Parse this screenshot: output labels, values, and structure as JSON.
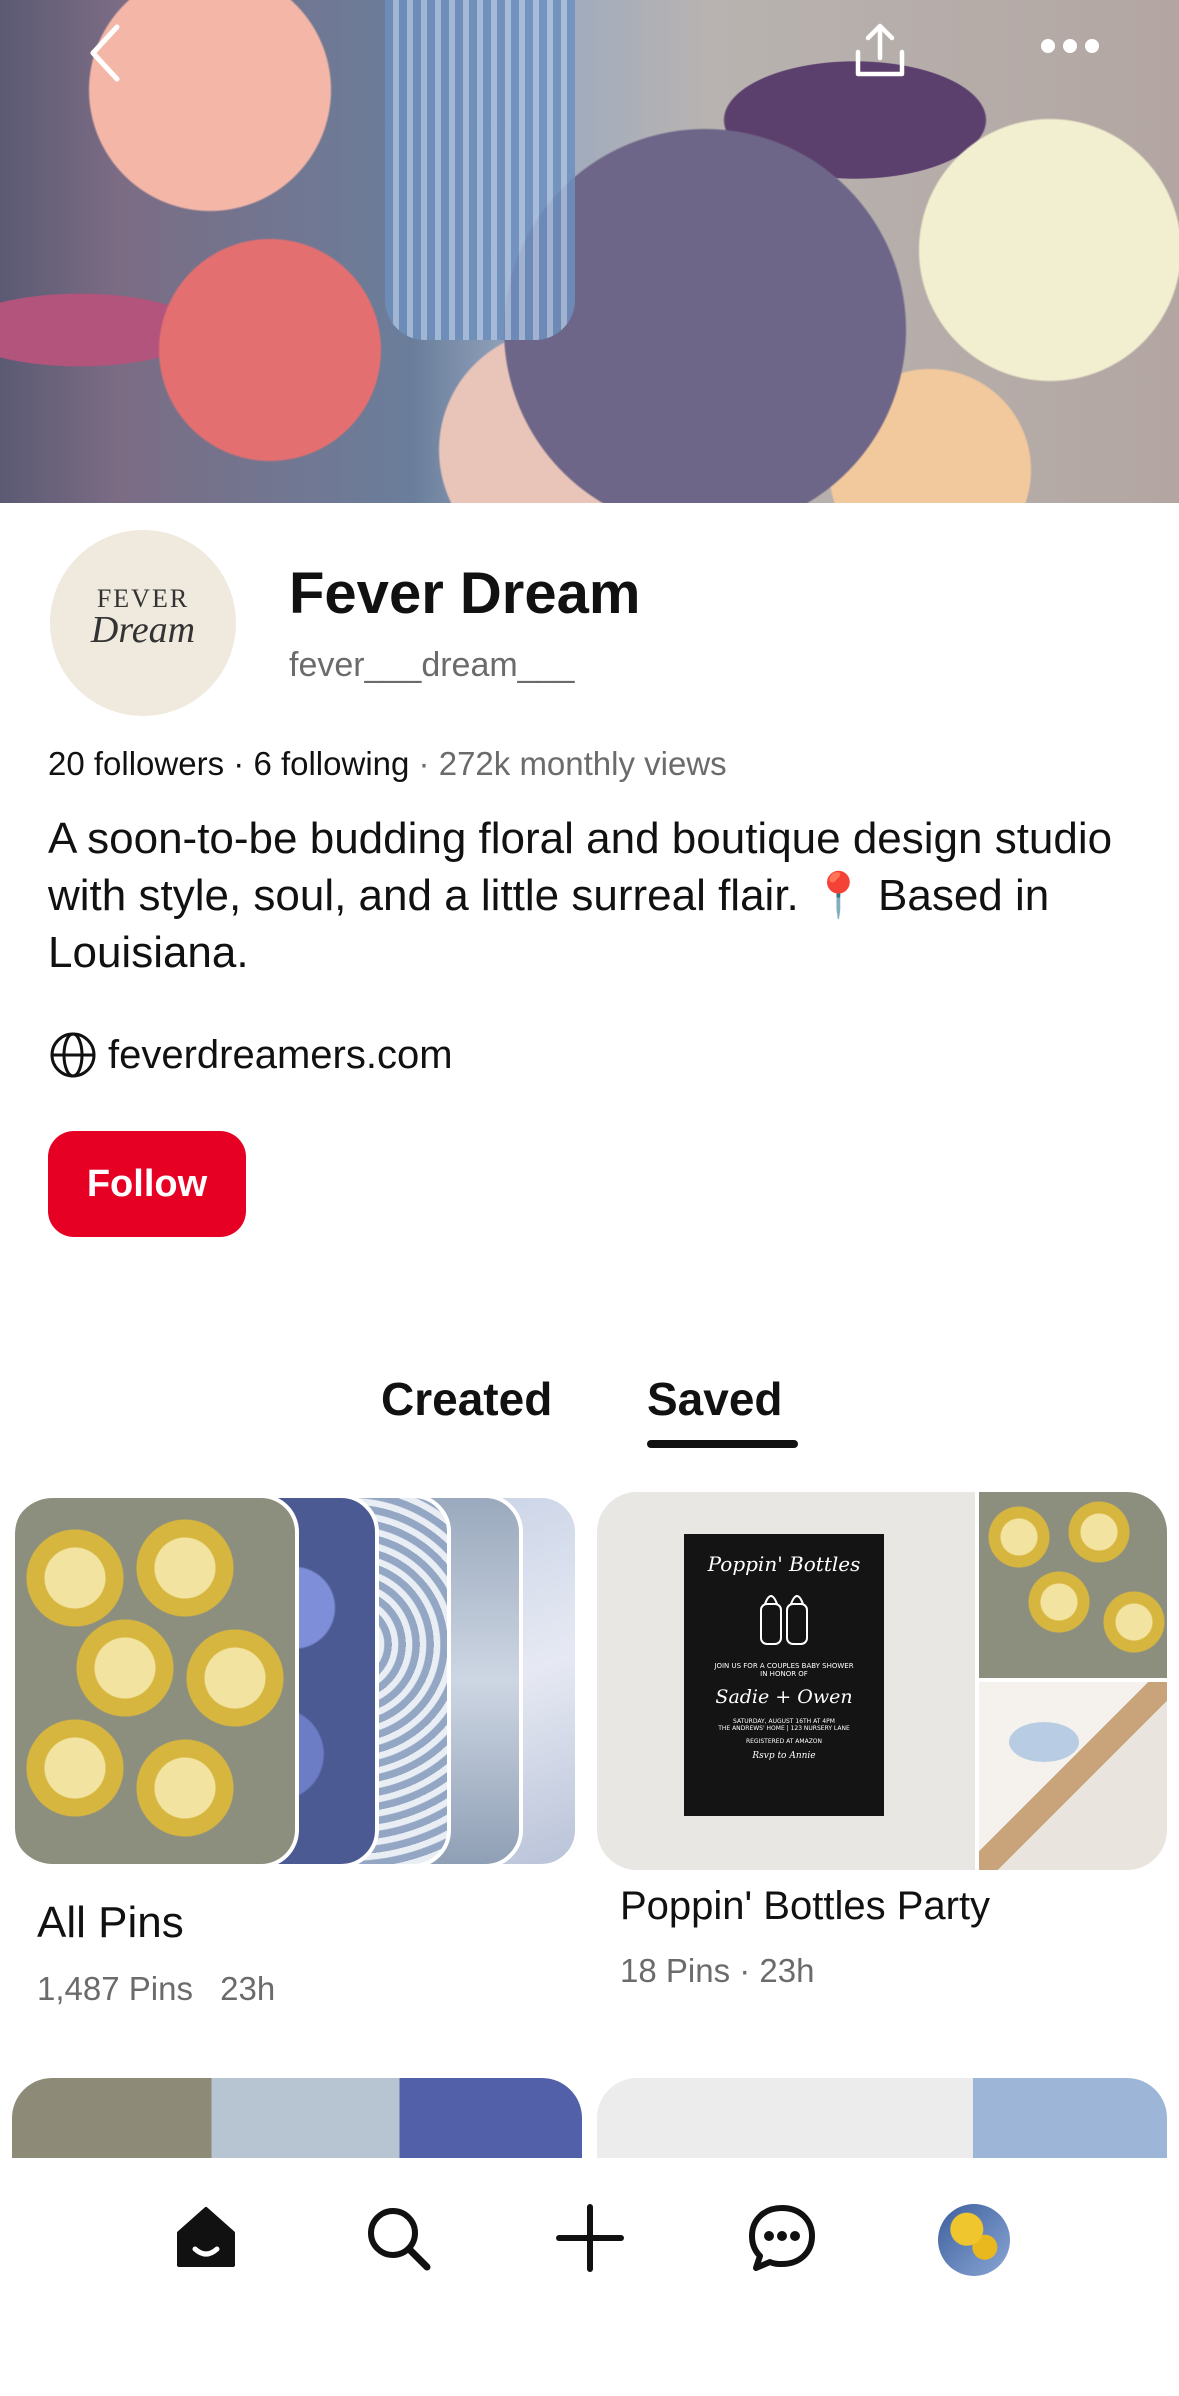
{
  "header": {
    "back_icon": "chevron-left-icon",
    "share_icon": "share-upload-icon",
    "more_icon": "more-horizontal-icon"
  },
  "profile": {
    "avatar_logo_line1": "FEVER",
    "avatar_logo_line2": "Dream",
    "name": "Fever Dream",
    "handle": "fever___dream___",
    "followers": "20 followers",
    "following": "6 following",
    "monthly_views": "272k monthly views",
    "bio": "A soon-to-be budding floral and boutique design studio with style, soul, and a little surreal flair. 📍 Based in Louisiana.",
    "website": "feverdreamers.com",
    "follow_label": "Follow"
  },
  "tabs": {
    "created": "Created",
    "saved": "Saved",
    "active": "saved"
  },
  "boards": [
    {
      "title": "All Pins",
      "pins": "1,487 Pins",
      "updated": "23h"
    },
    {
      "title": "Poppin' Bottles Party",
      "meta": "18 Pins · 23h",
      "invite": {
        "heading": "Poppin' Bottles",
        "line1": "JOIN US FOR A COUPLES BABY SHOWER",
        "line2": "IN HONOR OF",
        "names": "Sadie + Owen",
        "line3": "SATURDAY, AUGUST 16TH AT 4PM",
        "line4": "THE ANDREWS' HOME | 123 NURSERY LANE",
        "line5": "REGISTERED AT AMAZON",
        "line6": "Rsvp to Annie"
      }
    }
  ],
  "bottom_nav": [
    "home-icon",
    "search-icon",
    "create-plus-icon",
    "messages-icon",
    "profile-avatar"
  ],
  "colors": {
    "accent": "#e60023",
    "muted_text": "#6b6b6b"
  }
}
